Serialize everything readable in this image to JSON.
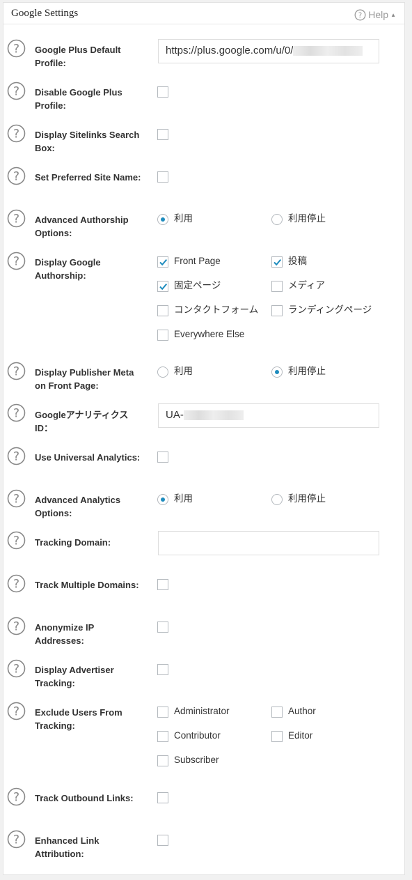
{
  "panel": {
    "title": "Google Settings",
    "help_label": "Help",
    "help_icon": "question-circle-icon",
    "caret_icon": "triangle-up-icon"
  },
  "rows": {
    "gplus_profile": {
      "label": "Google Plus Default Profile:",
      "value": "https://plus.google.com/u/0/"
    },
    "disable_gplus": {
      "label": "Disable Google Plus Profile:",
      "checked": false
    },
    "sitelinks": {
      "label": "Display Sitelinks Search Box:",
      "checked": false
    },
    "pref_site_name": {
      "label": "Set Preferred Site Name:",
      "checked": false
    },
    "adv_authorship": {
      "label": "Advanced Authorship Options:",
      "opt1": "利用",
      "opt2": "利用停止",
      "selected": "利用"
    },
    "google_authorship": {
      "label": "Display Google Authorship:",
      "options": [
        {
          "label": "Front Page",
          "checked": true
        },
        {
          "label": "投稿",
          "checked": true
        },
        {
          "label": "固定ページ",
          "checked": true
        },
        {
          "label": "メディア",
          "checked": false
        },
        {
          "label": "コンタクトフォーム",
          "checked": false
        },
        {
          "label": "ランディングページ",
          "checked": false
        },
        {
          "label": "Everywhere Else",
          "checked": false
        }
      ]
    },
    "publisher_meta": {
      "label": "Display Publisher Meta on Front Page:",
      "opt1": "利用",
      "opt2": "利用停止",
      "selected": "利用停止"
    },
    "analytics_id": {
      "label": "Googleアナリティクス ID：",
      "value": "UA-"
    },
    "universal": {
      "label": "Use Universal Analytics:",
      "checked": false
    },
    "adv_analytics": {
      "label": "Advanced Analytics Options:",
      "opt1": "利用",
      "opt2": "利用停止",
      "selected": "利用"
    },
    "tracking_domain": {
      "label": "Tracking Domain:",
      "value": ""
    },
    "multiple_domains": {
      "label": "Track Multiple Domains:",
      "checked": false
    },
    "anonymize": {
      "label": "Anonymize IP Addresses:",
      "checked": false
    },
    "advertiser": {
      "label": "Display Advertiser Tracking:",
      "checked": false
    },
    "exclude_users": {
      "label": "Exclude Users From Tracking:",
      "options": [
        {
          "label": "Administrator",
          "checked": false
        },
        {
          "label": "Author",
          "checked": false
        },
        {
          "label": "Contributor",
          "checked": false
        },
        {
          "label": "Editor",
          "checked": false
        },
        {
          "label": "Subscriber",
          "checked": false
        }
      ]
    },
    "outbound": {
      "label": "Track Outbound Links:",
      "checked": false
    },
    "enhanced_link": {
      "label": "Enhanced Link Attribution:",
      "checked": false
    }
  }
}
